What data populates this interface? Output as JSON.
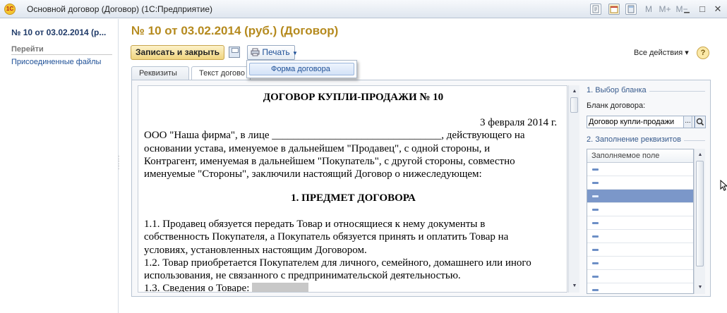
{
  "window": {
    "logo_text": "1С",
    "title": "Основной договор (Договор)  (1С:Предприятие)",
    "toolbar": {
      "m_label": "M",
      "m_plus_label": "M+",
      "m_minus_label": "M−"
    },
    "controls": {
      "minimize": "▁",
      "maximize": "□",
      "close": "✕"
    }
  },
  "left_panel": {
    "title": "№ 10 от 03.02.2014 (р...",
    "section_label": "Перейти",
    "links": [
      "Присоединенные файлы"
    ]
  },
  "header": {
    "title": "№ 10 от 03.02.2014 (руб.) (Договор)"
  },
  "command_bar": {
    "save_close_label": "Записать и закрыть",
    "print_label": "Печать",
    "all_actions_label": "Все действия ▾",
    "help_label": "?"
  },
  "print_menu": {
    "items": [
      "Форма договора"
    ]
  },
  "tabs": [
    {
      "label": "Реквизиты",
      "active": false
    },
    {
      "label": "Текст догово",
      "active": true
    }
  ],
  "document": {
    "heading": "ДОГОВОР КУПЛИ-ПРОДАЖИ № 10",
    "date": "3 февраля 2014 г.",
    "paragraph1": [
      "ООО \"Наша фирма\", в лице ________________________________, действующего на",
      "основании устава, именуемое в дальнейшем \"Продавец\", с одной стороны, и",
      "Контрагент, именуемая в дальнейшем \"Покупатель\", с другой стороны, совместно",
      "именуемые \"Стороны\", заключили настоящий Договор о нижеследующем:"
    ],
    "section1_heading": "1. ПРЕДМЕТ ДОГОВОРА",
    "section1_lines": [
      "1.1. Продавец обязуется передать Товар и относящиеся к нему документы в",
      "собственность Покупателя, а Покупатель обязуется принять и оплатить Товар на",
      "условиях, установленных настоящим Договором.",
      "1.2. Товар приобретается Покупателем для личного, семейного, домашнего или иного",
      "использования, не связанного с предпринимательской деятельностью."
    ],
    "section1_3_label": "1.3. Сведения о Товаре: "
  },
  "right_panel": {
    "group1_caption": "1. Выбор бланка",
    "blank_label": "Бланк договора:",
    "blank_value": "Договор купли-продажи",
    "select_button_label": "...",
    "group2_caption": "2. Заполнение реквизитов",
    "grid_header": "Заполняемое поле",
    "selected_row_index": 2,
    "row_count": 10
  },
  "colors": {
    "title_gold": "#b58a1e",
    "link_blue": "#1d4f96",
    "selection": "#7b97c9"
  }
}
